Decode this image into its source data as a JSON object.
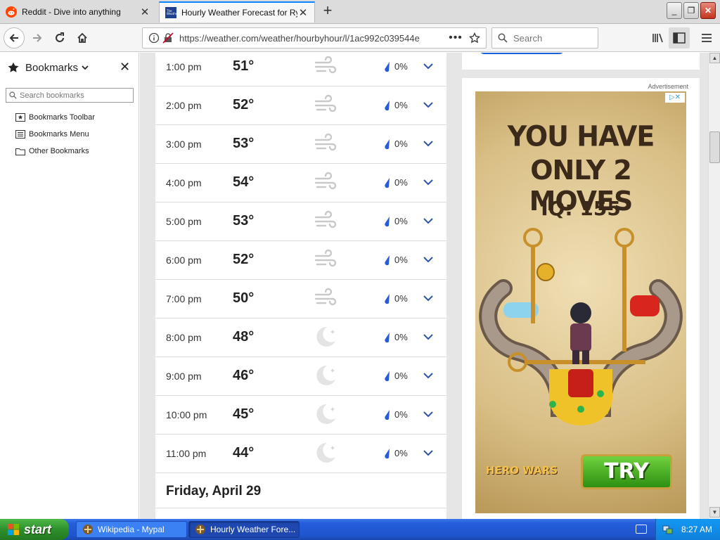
{
  "browser": {
    "tabs": [
      {
        "title": "Reddit - Dive into anything",
        "active": false,
        "favicon": "reddit-icon"
      },
      {
        "title": "Hourly Weather Forecast for Rye,",
        "active": true,
        "favicon": "weather-channel-icon"
      }
    ],
    "url": "https://weather.com/weather/hourbyhour/l/1ac992c039544e",
    "search_placeholder": "Search",
    "page_actions_icon": "ellipsis-icon",
    "bookmark_star_icon": "star-icon"
  },
  "sidebar": {
    "title": "Bookmarks",
    "search_placeholder": "Search bookmarks",
    "items": [
      {
        "label": "Bookmarks Toolbar",
        "icon": "toolbar-icon"
      },
      {
        "label": "Bookmarks Menu",
        "icon": "menu-list-icon"
      },
      {
        "label": "Other Bookmarks",
        "icon": "folder-icon"
      }
    ]
  },
  "forecast": {
    "rows": [
      {
        "time": "1:00 pm",
        "temp": "51°",
        "condition": "wind-icon",
        "precip": "0%"
      },
      {
        "time": "2:00 pm",
        "temp": "52°",
        "condition": "wind-icon",
        "precip": "0%"
      },
      {
        "time": "3:00 pm",
        "temp": "53°",
        "condition": "wind-icon",
        "precip": "0%"
      },
      {
        "time": "4:00 pm",
        "temp": "54°",
        "condition": "wind-icon",
        "precip": "0%"
      },
      {
        "time": "5:00 pm",
        "temp": "53°",
        "condition": "wind-icon",
        "precip": "0%"
      },
      {
        "time": "6:00 pm",
        "temp": "52°",
        "condition": "wind-icon",
        "precip": "0%"
      },
      {
        "time": "7:00 pm",
        "temp": "50°",
        "condition": "wind-icon",
        "precip": "0%"
      },
      {
        "time": "8:00 pm",
        "temp": "48°",
        "condition": "moon-icon",
        "precip": "0%"
      },
      {
        "time": "9:00 pm",
        "temp": "46°",
        "condition": "moon-icon",
        "precip": "0%"
      },
      {
        "time": "10:00 pm",
        "temp": "45°",
        "condition": "moon-icon",
        "precip": "0%"
      },
      {
        "time": "11:00 pm",
        "temp": "44°",
        "condition": "moon-icon",
        "precip": "0%"
      }
    ],
    "next_day": "Friday, April 29"
  },
  "ad": {
    "label": "Advertisement",
    "line1": "YOU HAVE",
    "line2": "ONLY 2 MOVES",
    "iq": "IQ: 155",
    "brand": "HERO WARS",
    "cta": "TRY"
  },
  "taskbar": {
    "start_label": "start",
    "items": [
      {
        "label": "Wikipedia - Mypal"
      },
      {
        "label": "Hourly Weather Fore..."
      }
    ],
    "clock": "8:27 AM"
  },
  "colors": {
    "accent_blue": "#1a5fdc",
    "precip_drop": "#2a5bd7",
    "chevron": "#2f53a8"
  }
}
